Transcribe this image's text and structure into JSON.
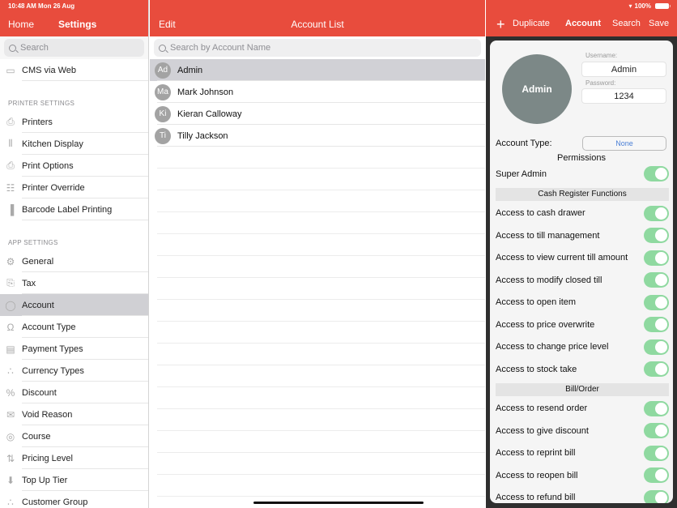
{
  "status_bar": {
    "time": "10:48 AM  Mon 26 Aug",
    "battery": "100%"
  },
  "settings_panel": {
    "nav": {
      "home_label": "Home",
      "title": "Settings"
    },
    "search_placeholder": "Search",
    "top_items": [
      {
        "label": "CMS via Web",
        "icon": "web-icon"
      }
    ],
    "printer_section": {
      "header": "PRINTER SETTINGS",
      "items": [
        {
          "label": "Printers",
          "icon": "printer-icon"
        },
        {
          "label": "Kitchen Display",
          "icon": "kitchen-display-icon"
        },
        {
          "label": "Print Options",
          "icon": "print-options-icon"
        },
        {
          "label": "Printer Override",
          "icon": "document-icon"
        },
        {
          "label": "Barcode Label Printing",
          "icon": "barcode-icon"
        }
      ]
    },
    "app_section": {
      "header": "APP SETTINGS",
      "items": [
        {
          "label": "General",
          "icon": "gear-icon"
        },
        {
          "label": "Tax",
          "icon": "tax-icon"
        },
        {
          "label": "Account",
          "icon": "user-icon",
          "selected": true
        },
        {
          "label": "Account Type",
          "icon": "user-type-icon"
        },
        {
          "label": "Payment Types",
          "icon": "payment-icon"
        },
        {
          "label": "Currency Types",
          "icon": "currency-icon"
        },
        {
          "label": "Discount",
          "icon": "discount-icon"
        },
        {
          "label": "Void Reason",
          "icon": "void-icon"
        },
        {
          "label": "Course",
          "icon": "course-icon"
        },
        {
          "label": "Pricing Level",
          "icon": "pricing-level-icon"
        },
        {
          "label": "Top Up Tier",
          "icon": "top-up-icon"
        },
        {
          "label": "Customer Group",
          "icon": "customer-group-icon"
        }
      ]
    }
  },
  "account_list": {
    "nav": {
      "edit_label": "Edit",
      "title": "Account List"
    },
    "search_placeholder": "Search by Account Name",
    "accounts": [
      {
        "initials": "Ad",
        "name": "Admin",
        "selected": true
      },
      {
        "initials": "Ma",
        "name": "Mark Johnson"
      },
      {
        "initials": "Ki",
        "name": "Kieran Calloway"
      },
      {
        "initials": "Ti",
        "name": "Tilly Jackson"
      }
    ]
  },
  "account_detail": {
    "nav": {
      "add_label": "+",
      "duplicate_label": "Duplicate",
      "title": "Account",
      "search_label": "Search",
      "save_label": "Save"
    },
    "avatar_label": "Admin",
    "username_label": "Username:",
    "username_value": "Admin",
    "password_label": "Password:",
    "password_value": "1234",
    "account_type_label": "Account Type:",
    "account_type_value": "None",
    "permissions_title": "Permissions",
    "super_admin": {
      "label": "Super Admin",
      "enabled": true
    },
    "groups": [
      {
        "title": "Cash Register Functions",
        "items": [
          {
            "label": "Access to cash drawer",
            "enabled": true
          },
          {
            "label": "Access to till management",
            "enabled": true
          },
          {
            "label": "Access to view current till amount",
            "enabled": true
          },
          {
            "label": "Access to modify closed till",
            "enabled": true
          },
          {
            "label": "Access to open item",
            "enabled": true
          },
          {
            "label": "Access to price overwrite",
            "enabled": true
          },
          {
            "label": "Access to change price level",
            "enabled": true
          },
          {
            "label": "Access to stock take",
            "enabled": true
          }
        ]
      },
      {
        "title": "Bill/Order",
        "items": [
          {
            "label": "Access to resend order",
            "enabled": true
          },
          {
            "label": "Access to give discount",
            "enabled": true
          },
          {
            "label": "Access to reprint bill",
            "enabled": true
          },
          {
            "label": "Access to reopen bill",
            "enabled": true
          },
          {
            "label": "Access to refund bill",
            "enabled": true
          }
        ]
      }
    ]
  },
  "colors": {
    "brand_red": "#e84c3d",
    "toggle_on": "#8fd9a0",
    "link_blue": "#4a7fd6",
    "avatar_gray": "#7c8887"
  }
}
